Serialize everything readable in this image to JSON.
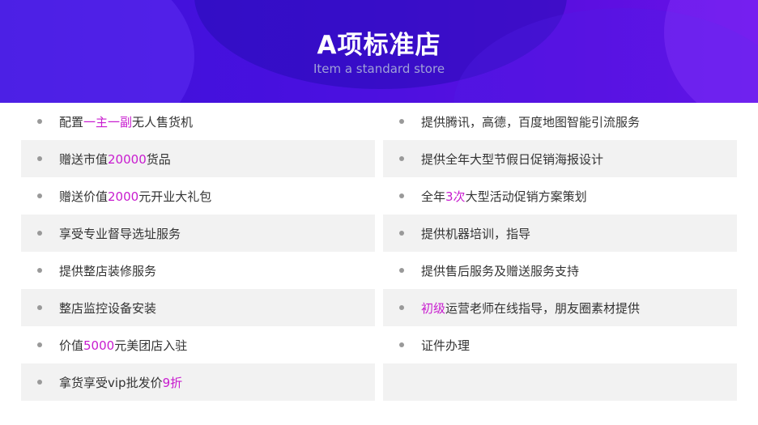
{
  "header": {
    "title": "A项标准店",
    "subtitle": "Item a standard store"
  },
  "colors": {
    "accent": "#c81ccf",
    "header_start": "#3b12d8",
    "header_end": "#6a10e8",
    "row_shade": "#f2f2f2",
    "text": "#333333"
  },
  "left_items": [
    {
      "pre": "配置",
      "hl": "一主一副",
      "post": "无人售货机"
    },
    {
      "pre": "赠送市值",
      "hl": "20000",
      "post": "货品"
    },
    {
      "pre": "赠送价值",
      "hl": "2000",
      "post": "元开业大礼包"
    },
    {
      "pre": "享受专业督导选址服务",
      "hl": "",
      "post": ""
    },
    {
      "pre": "提供整店装修服务",
      "hl": "",
      "post": ""
    },
    {
      "pre": "整店监控设备安装",
      "hl": "",
      "post": ""
    },
    {
      "pre": "价值",
      "hl": "5000",
      "post": "元美团店入驻"
    },
    {
      "pre": "拿货享受vip批发价",
      "hl": "9折",
      "post": ""
    }
  ],
  "right_items": [
    {
      "pre": "提供腾讯，高德，百度地图智能引流服务",
      "hl": "",
      "post": ""
    },
    {
      "pre": "提供全年大型节假日促销海报设计",
      "hl": "",
      "post": ""
    },
    {
      "pre": "全年",
      "hl": "3次",
      "post": "大型活动促销方案策划"
    },
    {
      "pre": "提供机器培训，指导",
      "hl": "",
      "post": ""
    },
    {
      "pre": "提供售后服务及赠送服务支持",
      "hl": "",
      "post": ""
    },
    {
      "pre": "",
      "hl": "初级",
      "post": "运营老师在线指导，朋友圈素材提供"
    },
    {
      "pre": "证件办理",
      "hl": "",
      "post": ""
    }
  ]
}
